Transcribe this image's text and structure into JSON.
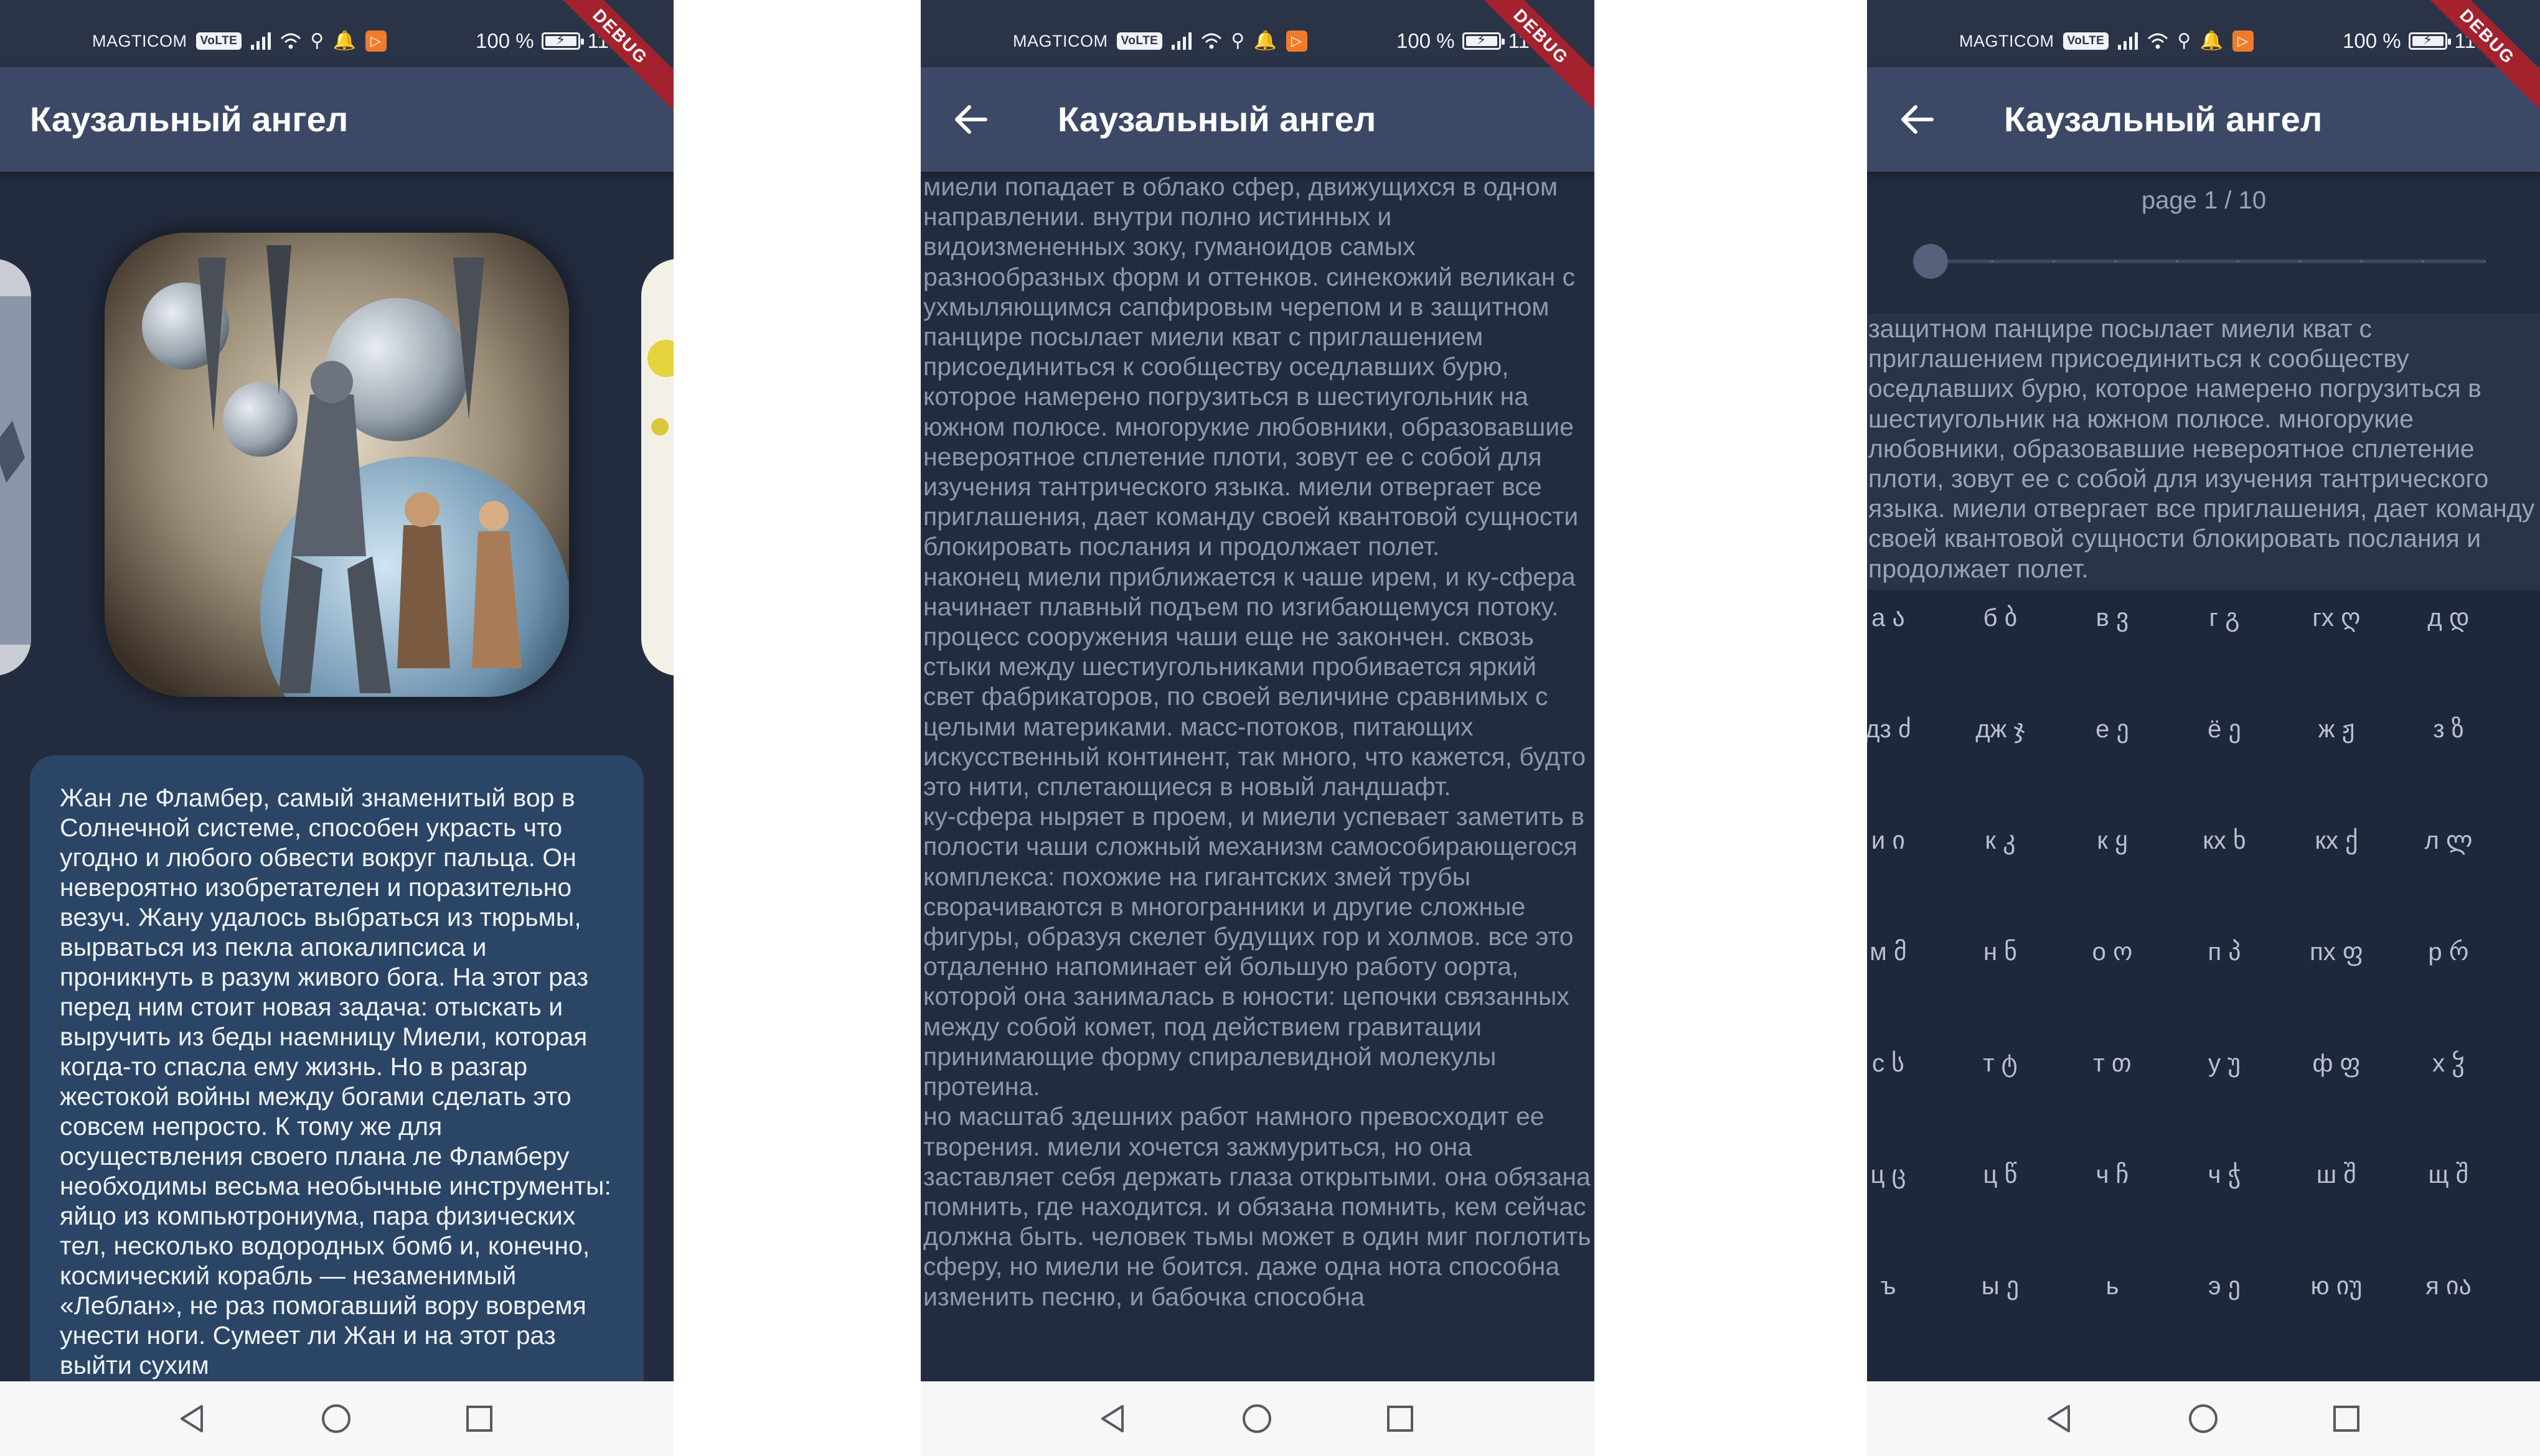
{
  "screens": [
    {
      "status": {
        "carrier": "MAGTICOM",
        "network": "VoLTE",
        "battery": "100 %",
        "time": "11:58"
      },
      "debug_label": "DEBUG",
      "appbar": {
        "title": "Каузальный ангел"
      },
      "summary": "Жан ле Фламбер, самый знаменитый вор в Солнечной системе, способен украсть что угодно и любого обвести вокруг пальца. Он невероятно изобретателен и поразительно везуч. Жану удалось выбраться из тюрьмы, вырваться из пекла апокалипсиса и проникнуть в разум живого бога. На этот раз перед ним стоит новая задача: отыскать и выручить из беды наемницу Миели, которая когда-то спасла ему жизнь. Но в разгар жестокой войны между богами сделать это совсем непросто. К тому же для осуществления своего плана ле Фламберу необходимы весьма необычные инструменты: яйцо из компьютрониума, пара физических тел, несколько водородных бомб и, конечно, космический корабль — незаменимый «Леблан», не раз помогавший вору вовремя унести ноги. Сумеет ли Жан и на этот раз выйти сухим"
    },
    {
      "status": {
        "carrier": "MAGTICOM",
        "network": "VoLTE",
        "battery": "100 %",
        "time": "11:58"
      },
      "debug_label": "DEBUG",
      "appbar": {
        "title": "Каузальный ангел"
      },
      "reader_text": " миели попадает в облако сфер, движущихся в одном направлении. внутри полно истинных и видоизмененных зоку, гуманоидов самых разнообразных форм и оттенков. синекожий великан с ухмыляющимся сапфировым черепом и в защитном панцире посылает миели кват с приглашением присоединиться к сообществу оседлавших бурю, которое намерено погрузиться в шестиугольник на южном полюсе. многорукие любовники, образовавшие невероятное сплетение плоти, зовут ее с собой для изучения тантрического языка. миели отвергает все приглашения, дает команду своей квантовой сущности блокировать послания и продолжает полет.\nнаконец миели приближается к чаше ирем, и ку-сфера начинает плавный подъем по изгибающемуся потоку. процесс сооружения чаши еще не закончен. сквозь стыки между шестиугольниками пробивается яркий свет фабрикаторов, по своей величине сравнимых с целыми материками. масс-потоков, питающих искусственный континент, так много, что кажется, будто это нити, сплетающиеся в новый ландшафт.\nку-сфера ныряет в проем, и миели успевает заметить в полости чаши сложный механизм самособирающегося комплекса: похожие на гигантских змей трубы сворачиваются в многогранники и другие сложные фигуры, образуя скелет будущих гор и холмов. все это отдаленно напоминает ей большую работу оорта, которой она занималась в юности: цепочки связанных между собой комет, под действием гравитации принимающие форму спиралевидной молекулы протеина.\nно масштаб здешних работ намного превосходит ее творения. миели хочется зажмуриться, но она заставляет себя держать глаза открытыми. она обязана помнить, где находится. и обязана помнить, кем сейчас должна быть. человек тьмы может в один миг поглотить сферу, но миели не боится. даже одна нота способна изменить песню, и бабочка способна"
    },
    {
      "status": {
        "carrier": "MAGTICOM",
        "network": "VoLTE",
        "battery": "100 %",
        "time": "11:58"
      },
      "debug_label": "DEBUG",
      "appbar": {
        "title": "Каузальный ангел"
      },
      "page_indicator": "page 1 / 10",
      "slider": {
        "value": 1,
        "min": 1,
        "max": 10
      },
      "excerpt": "защитном панцире посылает миели кват с приглашением присоединиться к сообществу оседлавших бурю, которое намерено погрузиться в шестиугольник на южном полюсе. многорукие любовники, образовавшие невероятное сплетение плоти, зовут ее с собой для изучения тантрического языка. миели отвергает все приглашения, дает команду своей квантовой сущности блокировать послания и продолжает полет.",
      "alphabet": [
        [
          "а ა",
          "б ბ",
          "в ვ",
          "г გ",
          "гх ღ",
          "д დ"
        ],
        [
          "дз ძ",
          "дж ჯ",
          "е ე",
          "ё ე",
          "ж ჟ",
          "з ზ"
        ],
        [
          "и ი",
          "к კ",
          "к ყ",
          "кх ხ",
          "кх ქ",
          "л ლ"
        ],
        [
          "м მ",
          "н ნ",
          "о ო",
          "п პ",
          "пх ფ",
          "р რ"
        ],
        [
          "с ს",
          "т ტ",
          "т თ",
          "у უ",
          "ф ფ",
          "х ჴ"
        ],
        [
          "ц ც",
          "ц წ",
          "ч ჩ",
          "ч ჭ",
          "ш შ",
          "щ შ"
        ],
        [
          "ъ",
          "ы ე",
          "ь",
          "э ე",
          "ю იუ",
          "я ია"
        ]
      ]
    }
  ]
}
